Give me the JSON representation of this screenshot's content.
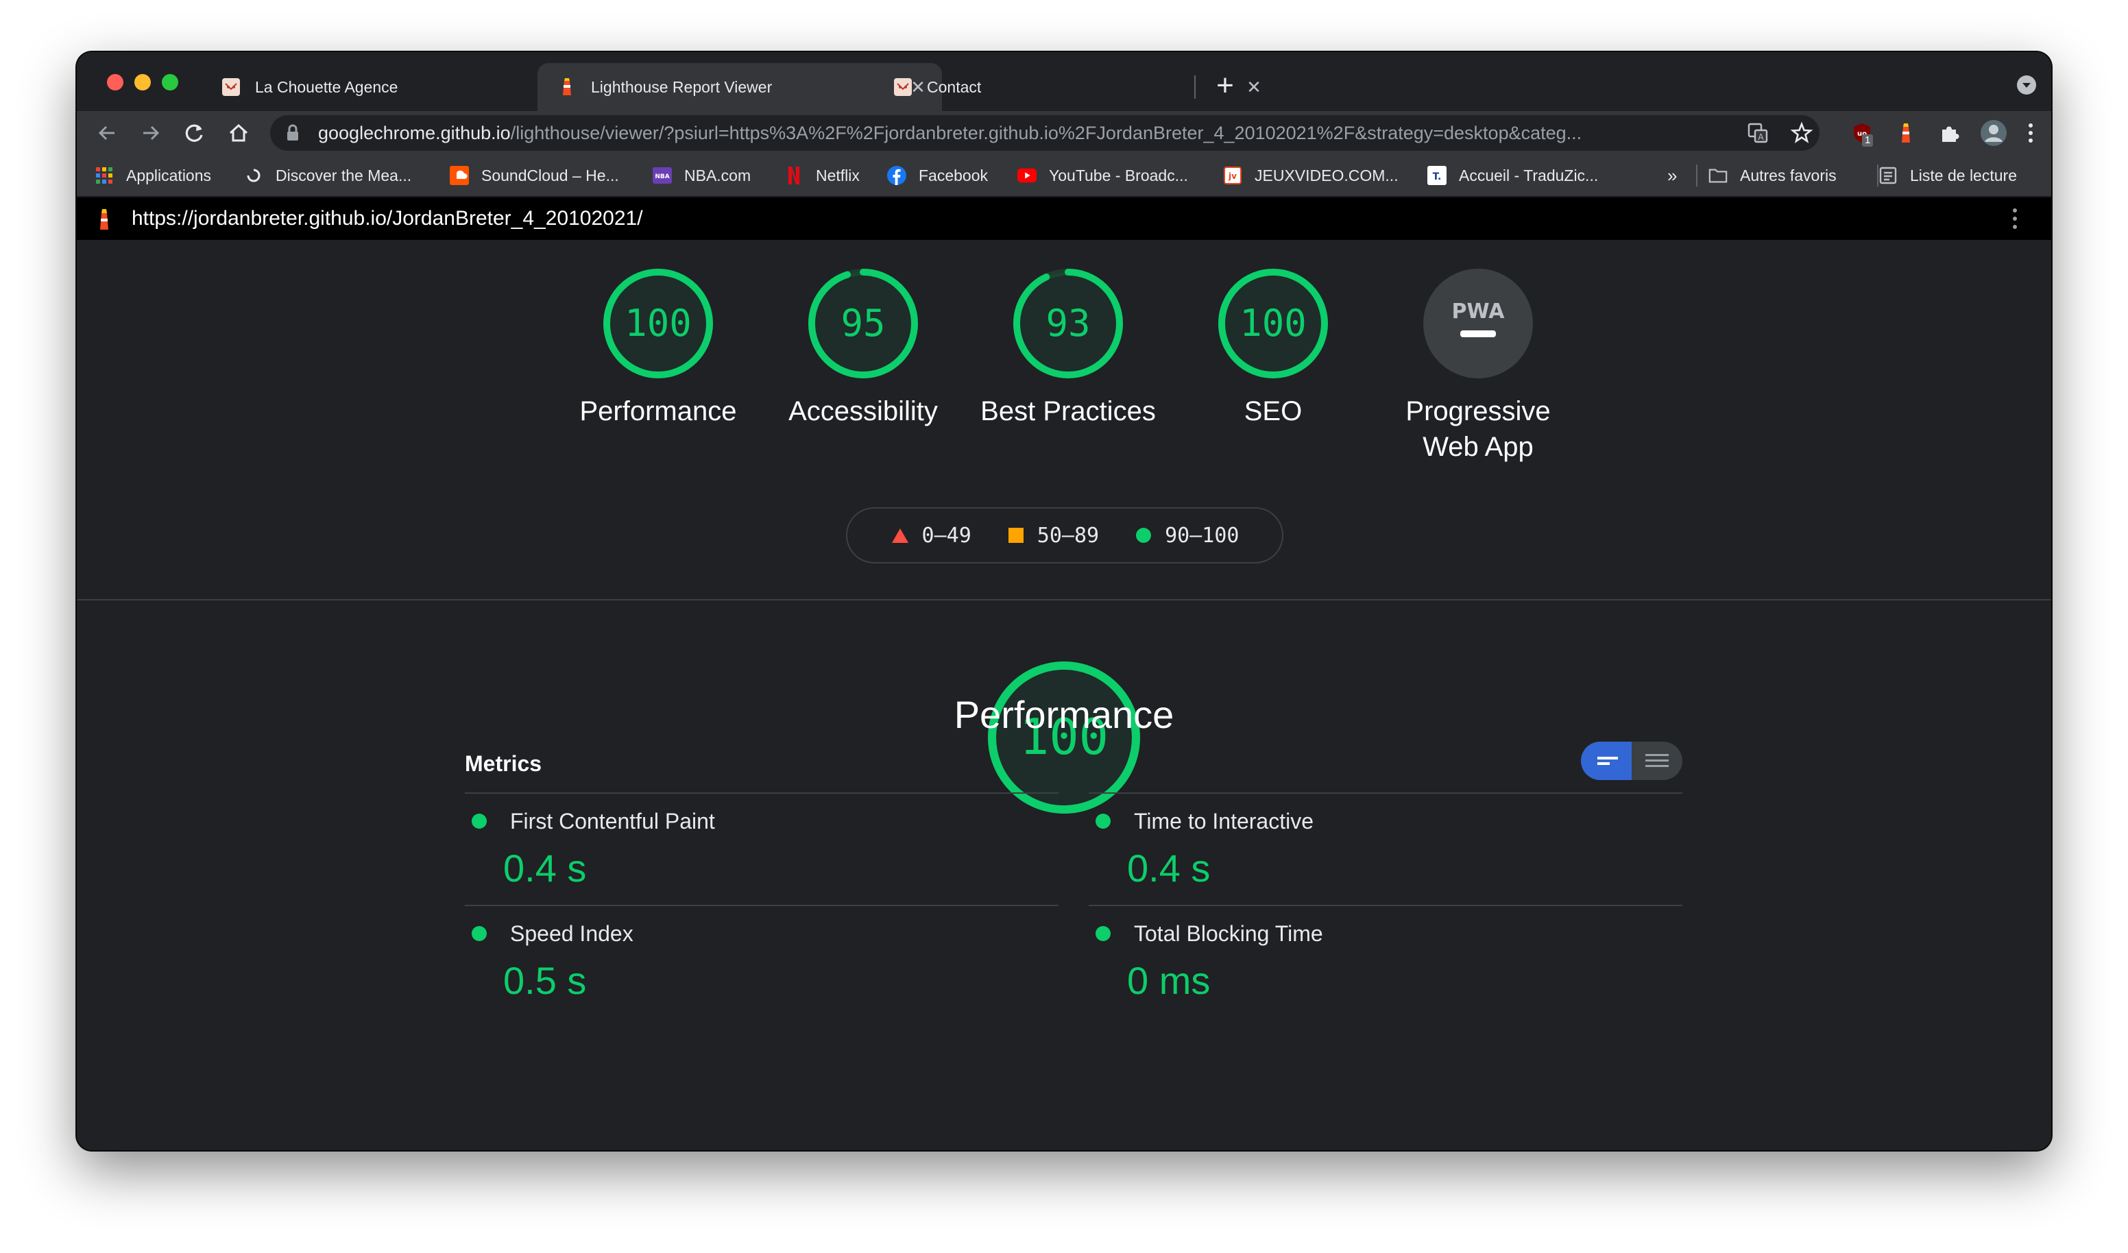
{
  "colors": {
    "pass": "#0cce6b",
    "average": "#ffa400",
    "fail": "#ff4e42",
    "toggle_active": "#3367d6"
  },
  "browser": {
    "tabs": [
      {
        "label": "La Chouette Agence",
        "icon": "owl-logo-icon",
        "active": false
      },
      {
        "label": "Lighthouse Report Viewer",
        "icon": "lighthouse-icon",
        "active": true
      },
      {
        "label": "Contact",
        "icon": "owl-logo-icon",
        "active": false
      }
    ],
    "new_tab": "+",
    "address": {
      "host": "googlechrome.github.io",
      "path": "/lighthouse/viewer/?psiurl=https%3A%2F%2Fjordanbreter.github.io%2FJordanBreter_4_20102021%2F&strategy=desktop&categ..."
    },
    "bookmarks": [
      {
        "label": "Applications",
        "icon": "apps-grid-icon"
      },
      {
        "label": "Discover the Mea...",
        "icon": "spinner-logo-icon"
      },
      {
        "label": "SoundCloud – He...",
        "icon": "soundcloud-icon"
      },
      {
        "label": "NBA.com",
        "icon": "nba-icon"
      },
      {
        "label": "Netflix",
        "icon": "netflix-icon"
      },
      {
        "label": "Facebook",
        "icon": "facebook-icon"
      },
      {
        "label": "YouTube - Broadc...",
        "icon": "youtube-icon"
      },
      {
        "label": "JEUXVIDEO.COM...",
        "icon": "jeuxvideo-icon"
      },
      {
        "label": "Accueil - TraduZic...",
        "icon": "traduzic-icon"
      }
    ],
    "bookmarks_overflow": "»",
    "other_bookmarks": "Autres favoris",
    "reading_list": "Liste de lecture",
    "extension_badge": "1"
  },
  "report": {
    "url": "https://jordanbreter.github.io/JordanBreter_4_20102021/",
    "gauges": [
      {
        "label": "Performance",
        "score": 100
      },
      {
        "label": "Accessibility",
        "score": 95
      },
      {
        "label": "Best Practices",
        "score": 93
      },
      {
        "label": "SEO",
        "score": 100
      }
    ],
    "pwa": {
      "label_line1": "Progressive",
      "label_line2": "Web App",
      "badge": "PWA"
    },
    "legend": [
      {
        "range": "0–49",
        "shape": "triangle",
        "color": "#ff4e42"
      },
      {
        "range": "50–89",
        "shape": "square",
        "color": "#ffa400"
      },
      {
        "range": "90–100",
        "shape": "circle",
        "color": "#0cce6b"
      }
    ],
    "performance": {
      "score": 100,
      "title": "Performance"
    },
    "metrics_title": "Metrics",
    "metrics": [
      {
        "name": "First Contentful Paint",
        "value": "0.4 s"
      },
      {
        "name": "Time to Interactive",
        "value": "0.4 s"
      },
      {
        "name": "Speed Index",
        "value": "0.5 s"
      },
      {
        "name": "Total Blocking Time",
        "value": "0 ms"
      }
    ]
  }
}
